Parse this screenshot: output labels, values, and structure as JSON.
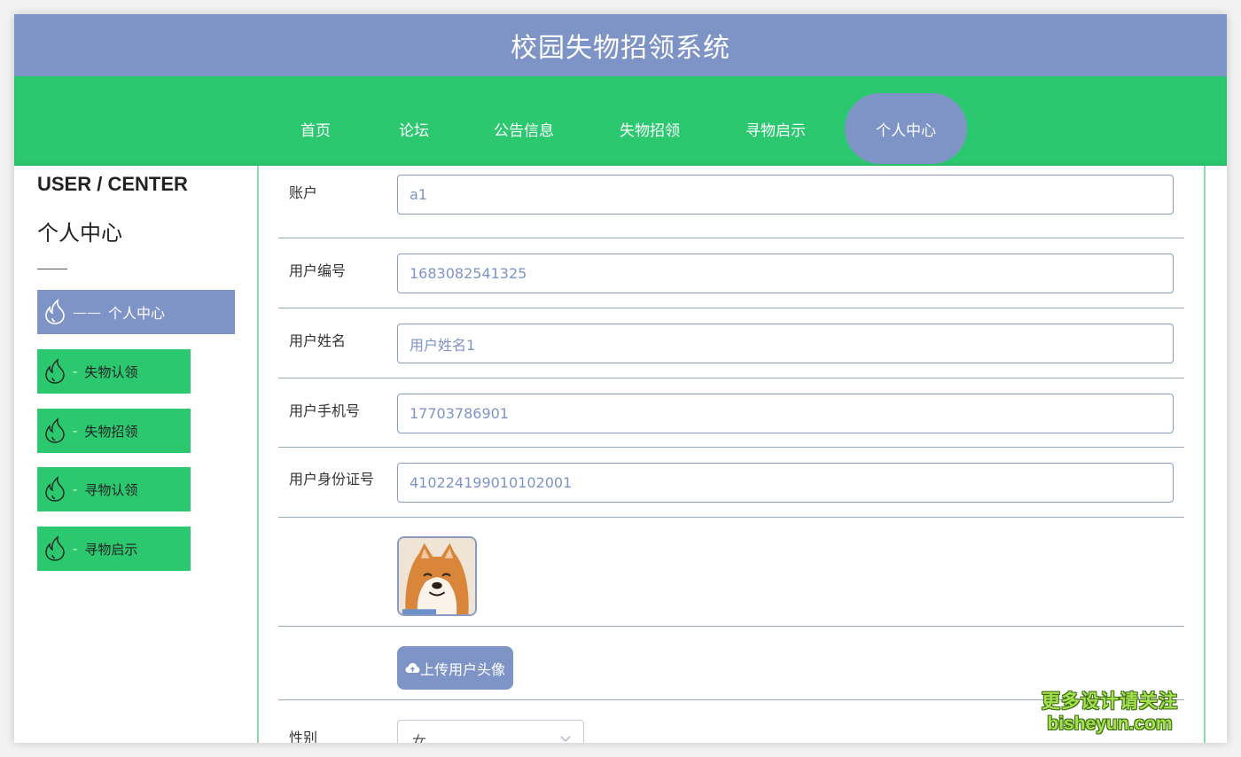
{
  "colors": {
    "header_bg": "#7f94c6",
    "nav_bg": "#2cc870",
    "accent_active": "#7f94c6",
    "menu_green": "#2cc870",
    "input_text": "#7f93c4"
  },
  "header": {
    "title": "校园失物招领系统"
  },
  "nav": {
    "items": [
      {
        "label": "首页"
      },
      {
        "label": "论坛"
      },
      {
        "label": "公告信息"
      },
      {
        "label": "失物招领"
      },
      {
        "label": "寻物启示"
      },
      {
        "label": "个人中心",
        "active": true
      }
    ]
  },
  "sidebar": {
    "title_en": "USER / CENTER",
    "title_cn": "个人中心",
    "items": [
      {
        "label": "个人中心",
        "dash": "——",
        "active": true,
        "icon": "flame-icon"
      },
      {
        "label": "失物认领",
        "dash": "-",
        "icon": "flame-icon"
      },
      {
        "label": "失物招领",
        "dash": "-",
        "icon": "flame-icon"
      },
      {
        "label": "寻物认领",
        "dash": "-",
        "icon": "flame-icon"
      },
      {
        "label": "寻物启示",
        "dash": "-",
        "icon": "flame-icon"
      }
    ]
  },
  "form": {
    "fields": [
      {
        "label": "账户",
        "value": "a1"
      },
      {
        "label": "用户编号",
        "value": "1683082541325"
      },
      {
        "label": "用户姓名",
        "value": "用户姓名1"
      },
      {
        "label": "用户手机号",
        "value": "17703786901"
      },
      {
        "label": "用户身份证号",
        "value": "410224199010102001"
      }
    ],
    "upload_label": "上传用户头像",
    "upload_icon": "cloud-upload-icon",
    "gender": {
      "label": "性别",
      "value": "女"
    }
  },
  "watermark": {
    "line1": "更多设计请关注",
    "line2": "bisheyun.com"
  }
}
